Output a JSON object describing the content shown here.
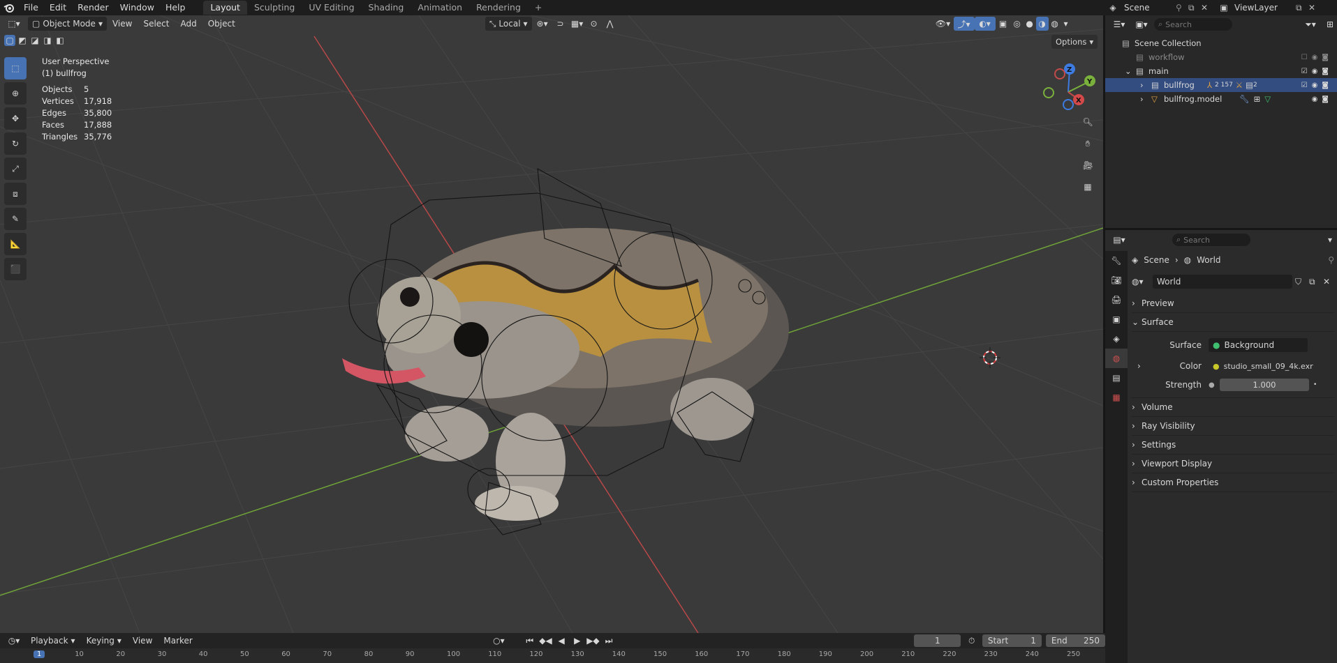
{
  "menu": {
    "items": [
      "File",
      "Edit",
      "Render",
      "Window",
      "Help"
    ]
  },
  "workspaces": {
    "tabs": [
      "Layout",
      "Sculpting",
      "UV Editing",
      "Shading",
      "Animation",
      "Rendering"
    ],
    "active": "Layout",
    "add": "+"
  },
  "scene": {
    "name": "Scene",
    "view_layer": "ViewLayer"
  },
  "viewport": {
    "mode": "Object Mode",
    "menus": [
      "View",
      "Select",
      "Add",
      "Object"
    ],
    "transform_orientation": "Local",
    "options_label": "Options",
    "perspective": "User Perspective",
    "active_object": "(1) bullfrog",
    "stats": [
      {
        "label": "Objects",
        "value": "5"
      },
      {
        "label": "Vertices",
        "value": "17,918"
      },
      {
        "label": "Edges",
        "value": "35,800"
      },
      {
        "label": "Faces",
        "value": "17,888"
      },
      {
        "label": "Triangles",
        "value": "35,776"
      }
    ],
    "gizmo_axes": {
      "z": "Z",
      "y": "Y",
      "x": "X"
    }
  },
  "outliner": {
    "search_placeholder": "Search",
    "root": "Scene Collection",
    "rows": [
      {
        "label": "workflow",
        "indent": 1
      },
      {
        "label": "main",
        "indent": 1
      },
      {
        "label": "bullfrog",
        "indent": 2,
        "badges": "2 157",
        "badge2": "2"
      },
      {
        "label": "bullfrog.model",
        "indent": 2
      }
    ]
  },
  "properties": {
    "search_placeholder": "Search",
    "breadcrumb": [
      "Scene",
      "World"
    ],
    "world_name": "World",
    "sections": {
      "preview": "Preview",
      "surface": "Surface",
      "volume": "Volume",
      "ray_visibility": "Ray Visibility",
      "settings": "Settings",
      "viewport_display": "Viewport Display",
      "custom_properties": "Custom Properties"
    },
    "surface": {
      "surface_label": "Surface",
      "surface_value": "Background",
      "color_label": "Color",
      "color_value": "studio_small_09_4k.exr",
      "strength_label": "Strength",
      "strength_value": "1.000"
    }
  },
  "timeline": {
    "menus": [
      "Playback",
      "Keying",
      "View",
      "Marker"
    ],
    "current_frame": "1",
    "start_label": "Start",
    "start_value": "1",
    "end_label": "End",
    "end_value": "250",
    "ruler_marks": [
      "1",
      "10",
      "20",
      "30",
      "40",
      "50",
      "60",
      "70",
      "80",
      "90",
      "100",
      "110",
      "120",
      "130",
      "140",
      "150",
      "160",
      "170",
      "180",
      "190",
      "200",
      "210",
      "220",
      "230",
      "240",
      "250"
    ]
  },
  "colors": {
    "accent": "#4772b3",
    "x_axis": "#c24a4a",
    "y_axis": "#7ab03c",
    "z_axis": "#3d7be0"
  }
}
